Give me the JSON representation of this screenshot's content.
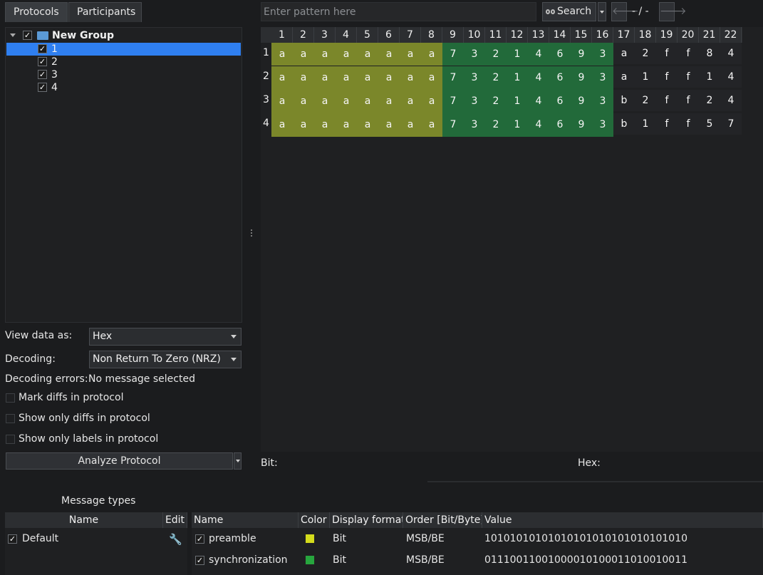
{
  "tabs": {
    "protocols": "Protocols",
    "participants": "Participants"
  },
  "tree": {
    "group_label": "New Group",
    "items": [
      "1",
      "2",
      "3",
      "4"
    ]
  },
  "search": {
    "placeholder": "Enter pattern here",
    "button_label": "Search",
    "results_label": "- / -"
  },
  "settings": {
    "view_data_label": "View data as:",
    "view_data_value": "Hex",
    "decoding_label": "Decoding:",
    "decoding_value": "Non Return To Zero (NRZ)",
    "errors_label": "Decoding errors:",
    "errors_value": "No message selected",
    "mark_diffs": "Mark diffs in protocol",
    "show_only_diffs": "Show only diffs in protocol",
    "show_only_labels": "Show only labels in protocol",
    "analyze_button": "Analyze Protocol"
  },
  "table": {
    "columns": [
      "1",
      "2",
      "3",
      "4",
      "5",
      "6",
      "7",
      "8",
      "9",
      "10",
      "11",
      "12",
      "13",
      "14",
      "15",
      "16",
      "17",
      "18",
      "19",
      "20",
      "21",
      "22"
    ],
    "rows": [
      {
        "label": "1",
        "cells": [
          "a",
          "a",
          "a",
          "a",
          "a",
          "a",
          "a",
          "a",
          "7",
          "3",
          "2",
          "1",
          "4",
          "6",
          "9",
          "3",
          "a",
          "2",
          "f",
          "f",
          "8",
          "4"
        ]
      },
      {
        "label": "2",
        "cells": [
          "a",
          "a",
          "a",
          "a",
          "a",
          "a",
          "a",
          "a",
          "7",
          "3",
          "2",
          "1",
          "4",
          "6",
          "9",
          "3",
          "a",
          "1",
          "f",
          "f",
          "1",
          "4"
        ]
      },
      {
        "label": "3",
        "cells": [
          "a",
          "a",
          "a",
          "a",
          "a",
          "a",
          "a",
          "a",
          "7",
          "3",
          "2",
          "1",
          "4",
          "6",
          "9",
          "3",
          "b",
          "2",
          "f",
          "f",
          "2",
          "4"
        ]
      },
      {
        "label": "4",
        "cells": [
          "a",
          "a",
          "a",
          "a",
          "a",
          "a",
          "a",
          "a",
          "7",
          "3",
          "2",
          "1",
          "4",
          "6",
          "9",
          "3",
          "b",
          "1",
          "f",
          "f",
          "5",
          "7"
        ]
      }
    ],
    "preamble_color": "#7b872a",
    "sync_color": "#226a3a"
  },
  "status": {
    "bit_label": "Bit:",
    "hex_label": "Hex:"
  },
  "message_types": {
    "title": "Message types",
    "headers": {
      "name": "Name",
      "edit": "Edit"
    },
    "items": [
      {
        "name": "Default"
      }
    ]
  },
  "labels_table": {
    "headers": {
      "name": "Name",
      "color": "Color",
      "display_format": "Display format",
      "order": "Order [Bit/Byte]",
      "value": "Value"
    },
    "rows": [
      {
        "name": "preamble",
        "color": "#d4dc1c",
        "display_format": "Bit",
        "order": "MSB/BE",
        "value": "10101010101010101010101010101010"
      },
      {
        "name": "synchronization",
        "color": "#27a63e",
        "display_format": "Bit",
        "order": "MSB/BE",
        "value": "01110011001000010100011010010011"
      }
    ]
  }
}
